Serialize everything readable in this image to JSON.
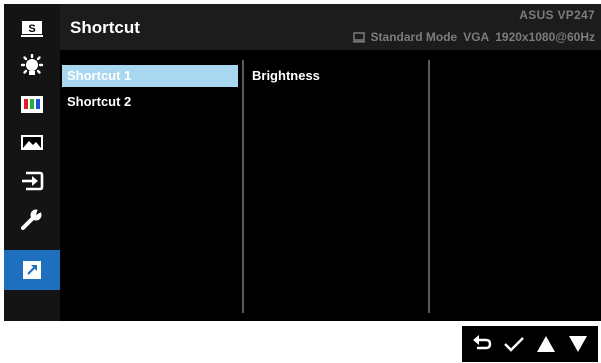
{
  "header": {
    "title": "Shortcut",
    "model": "ASUS  VP247",
    "mode": "Standard Mode",
    "input": "VGA",
    "resolution": "1920x1080@60Hz"
  },
  "sidebar": {
    "items": [
      {
        "name": "splendid",
        "icon": "splendid-s-icon"
      },
      {
        "name": "blue-light-filter",
        "icon": "light-bulb-icon"
      },
      {
        "name": "color",
        "icon": "color-bars-icon"
      },
      {
        "name": "image",
        "icon": "landscape-image-icon"
      },
      {
        "name": "input-select",
        "icon": "input-arrow-icon"
      },
      {
        "name": "system-setup",
        "icon": "wrench-icon"
      },
      {
        "name": "shortcut",
        "icon": "shortcut-arrow-icon",
        "active": true
      }
    ],
    "active_color": "#1f6fbf"
  },
  "menu": {
    "items": [
      {
        "label": "Shortcut 1",
        "selected": true
      },
      {
        "label": "Shortcut 2",
        "selected": false
      }
    ],
    "selected_color": "#a8d8f0"
  },
  "submenu": {
    "value": "Brightness"
  },
  "keys": [
    {
      "icon": "back-icon"
    },
    {
      "icon": "checkmark-icon"
    },
    {
      "icon": "up-arrow-icon"
    },
    {
      "icon": "down-arrow-icon"
    }
  ]
}
